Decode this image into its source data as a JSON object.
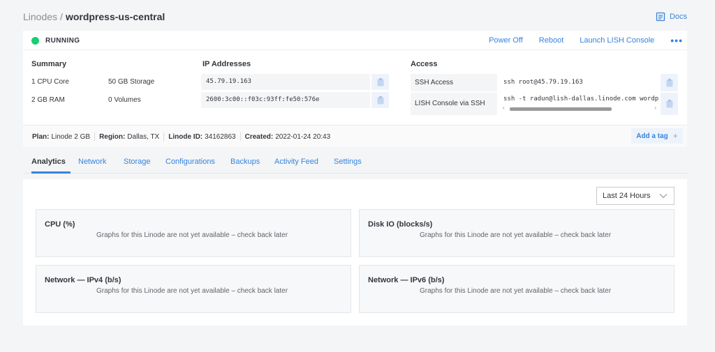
{
  "breadcrumb": {
    "root": "Linodes",
    "separator": "/",
    "current": "wordpress-us-central"
  },
  "docs_label": "Docs",
  "status": {
    "text": "RUNNING",
    "color": "#17cf73"
  },
  "actions": {
    "power_off": "Power Off",
    "reboot": "Reboot",
    "lish": "Launch LISH Console",
    "more": "•••"
  },
  "summary": {
    "title": "Summary",
    "cpu": "1 CPU Core",
    "storage": "50 GB Storage",
    "ram": "2 GB RAM",
    "volumes": "0 Volumes"
  },
  "ip": {
    "title": "IP Addresses",
    "addresses": [
      "45.79.19.163",
      "2600:3c00::f03c:93ff:fe50:576e"
    ]
  },
  "access": {
    "title": "Access",
    "ssh_label": "SSH Access",
    "ssh_value": "ssh root@45.79.19.163",
    "lish_label": "LISH Console via SSH",
    "lish_value": "ssh -t radun@lish-dallas.linode.com wordpress-us-central"
  },
  "info": {
    "plan_label": "Plan:",
    "plan_value": "Linode 2 GB",
    "region_label": "Region:",
    "region_value": "Dallas, TX",
    "id_label": "Linode ID:",
    "id_value": "34162863",
    "created_label": "Created:",
    "created_value": "2022-01-24 20:43"
  },
  "tag_button": {
    "label": "Add a tag",
    "plus": "+"
  },
  "tabs": [
    "Analytics",
    "Network",
    "Storage",
    "Configurations",
    "Backups",
    "Activity Feed",
    "Settings"
  ],
  "time_range": "Last 24 Hours",
  "graphs": [
    {
      "title": "CPU (%)",
      "message": "Graphs for this Linode are not yet available – check back later"
    },
    {
      "title": "Disk IO (blocks/s)",
      "message": "Graphs for this Linode are not yet available – check back later"
    },
    {
      "title": "Network — IPv4 (b/s)",
      "message": "Graphs for this Linode are not yet available – check back later"
    },
    {
      "title": "Network — IPv6 (b/s)",
      "message": "Graphs for this Linode are not yet available – check back later"
    }
  ],
  "icons": {
    "docs": "docs-icon",
    "copy": "clipboard-icon",
    "chevron": "chevron-down-icon"
  },
  "colors": {
    "accent": "#3683dc",
    "running": "#17cf73"
  }
}
